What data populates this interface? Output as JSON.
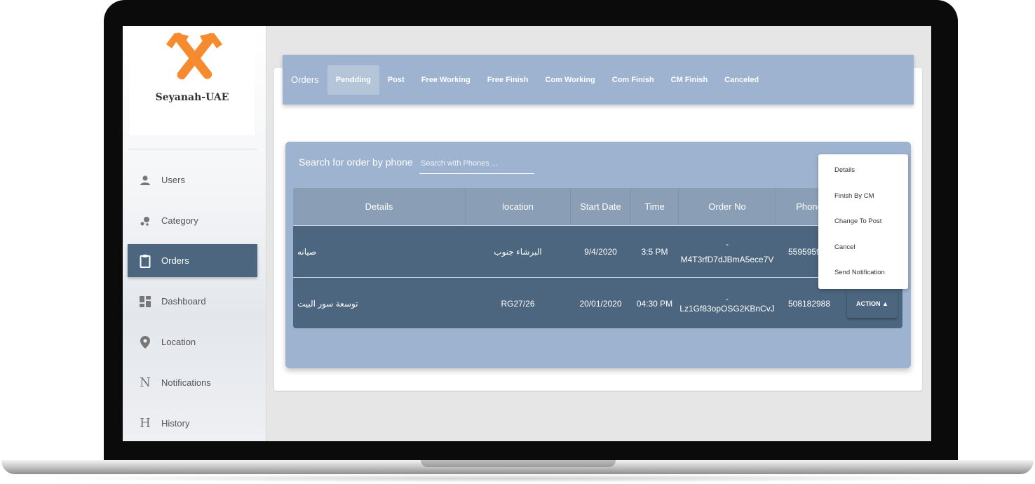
{
  "brand": {
    "name": "Seyanah-UAE",
    "accent": "#f58a2e"
  },
  "sidebar": {
    "items": [
      {
        "label": "Users",
        "icon": "user-icon"
      },
      {
        "label": "Category",
        "icon": "category-icon"
      },
      {
        "label": "Orders",
        "icon": "clipboard-icon",
        "active": true
      },
      {
        "label": "Dashboard",
        "icon": "dashboard-icon"
      },
      {
        "label": "Location",
        "icon": "location-pin-icon"
      },
      {
        "label": "Notifications",
        "icon": "letter-n-icon",
        "glyph": "N"
      },
      {
        "label": "History",
        "icon": "letter-h-icon",
        "glyph": "H"
      }
    ]
  },
  "tabs": {
    "title": "Orders",
    "items": [
      "Pendding",
      "Post",
      "Free Working",
      "Free Finish",
      "Com Working",
      "Com Finish",
      "CM Finish",
      "Canceled"
    ],
    "active": "Pendding"
  },
  "search": {
    "label": "Search for order by phone",
    "placeholder": "Search with Phones ..."
  },
  "table": {
    "columns": [
      "Details",
      "location",
      "Start Date",
      "Time",
      "Order No",
      "Phone"
    ],
    "rows": [
      {
        "details": "صيانه",
        "location": "البرشاء جنوب",
        "start_date": "9/4/2020",
        "time": "3:5 PM",
        "order_no_prefix": "-",
        "order_no": "M4T3rfD7dJBmA5ece7V",
        "phone": "5595959"
      },
      {
        "details": "توسعة سور البيت",
        "location": "RG27/26",
        "start_date": "20/01/2020",
        "time": "04:30 PM",
        "order_no": "-Lz1Gf83opOSG2KBnCvJ",
        "phone": "508182988",
        "action": "ACTION ▲"
      }
    ]
  },
  "action_menu": {
    "items": [
      "Details",
      "Finish By CM",
      "Change To Post",
      "Cancel",
      "Send Notification"
    ]
  },
  "colors": {
    "primary": "#4c6680",
    "panel": "#9db3cf",
    "header": "#8a9fb6"
  }
}
